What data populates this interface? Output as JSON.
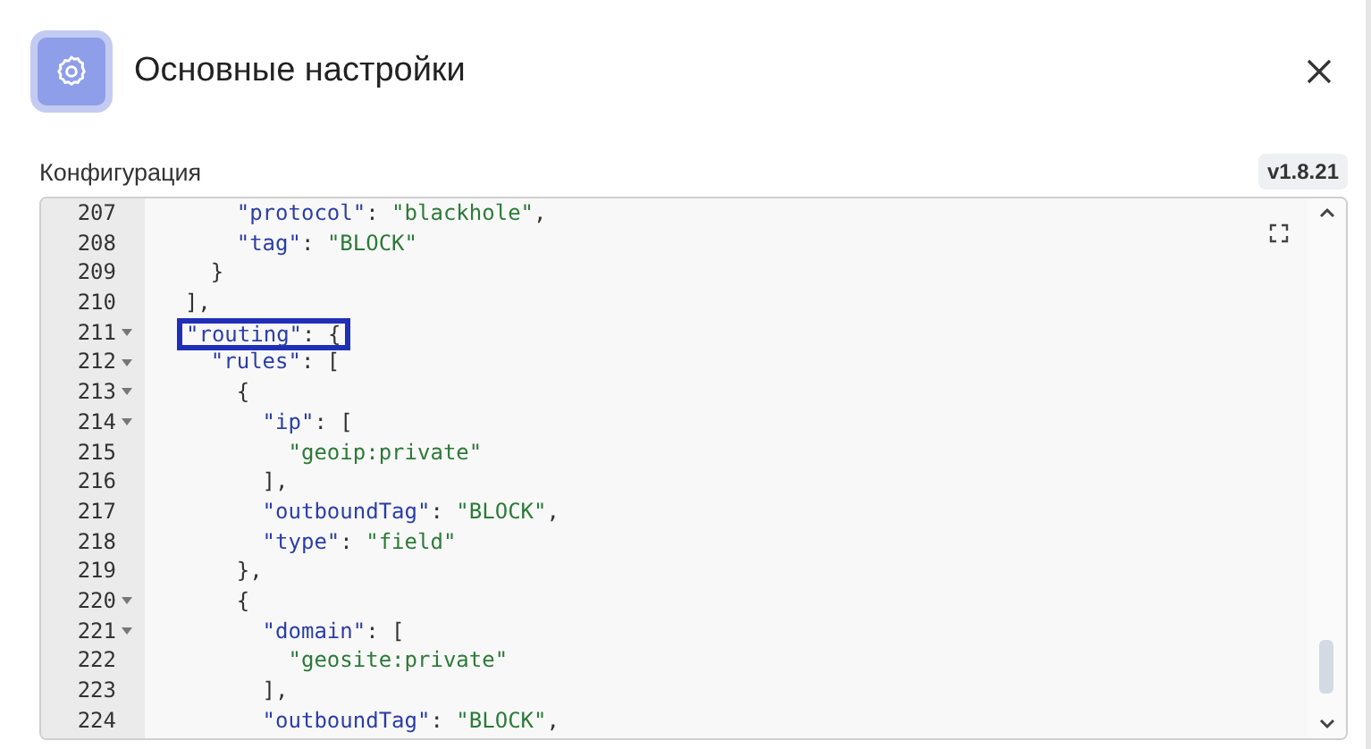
{
  "dialog": {
    "title": "Основные настройки"
  },
  "config": {
    "label": "Конфигурация",
    "version": "v1.8.21"
  },
  "editor": {
    "lines": [
      {
        "number": "207",
        "fold": false,
        "highlight": false,
        "tokens": [
          {
            "kind": "key",
            "text": "      \"protocol\""
          },
          {
            "kind": "punct",
            "text": ": "
          },
          {
            "kind": "string",
            "text": "\"blackhole\""
          },
          {
            "kind": "punct",
            "text": ","
          }
        ]
      },
      {
        "number": "208",
        "fold": false,
        "highlight": false,
        "tokens": [
          {
            "kind": "key",
            "text": "      \"tag\""
          },
          {
            "kind": "punct",
            "text": ": "
          },
          {
            "kind": "string",
            "text": "\"BLOCK\""
          }
        ]
      },
      {
        "number": "209",
        "fold": false,
        "highlight": false,
        "tokens": [
          {
            "kind": "punct",
            "text": "    }"
          }
        ]
      },
      {
        "number": "210",
        "fold": false,
        "highlight": false,
        "tokens": [
          {
            "kind": "punct",
            "text": "  ],"
          }
        ]
      },
      {
        "number": "211",
        "fold": true,
        "highlight": true,
        "tokens": [
          {
            "kind": "key",
            "text": "\"routing\""
          },
          {
            "kind": "punct",
            "text": ": {"
          }
        ]
      },
      {
        "number": "212",
        "fold": true,
        "highlight": false,
        "tokens": [
          {
            "kind": "key",
            "text": "    \"rules\""
          },
          {
            "kind": "punct",
            "text": ": ["
          }
        ]
      },
      {
        "number": "213",
        "fold": true,
        "highlight": false,
        "tokens": [
          {
            "kind": "punct",
            "text": "      {"
          }
        ]
      },
      {
        "number": "214",
        "fold": true,
        "highlight": false,
        "tokens": [
          {
            "kind": "key",
            "text": "        \"ip\""
          },
          {
            "kind": "punct",
            "text": ": ["
          }
        ]
      },
      {
        "number": "215",
        "fold": false,
        "highlight": false,
        "tokens": [
          {
            "kind": "string",
            "text": "          \"geoip:private\""
          }
        ]
      },
      {
        "number": "216",
        "fold": false,
        "highlight": false,
        "tokens": [
          {
            "kind": "punct",
            "text": "        ],"
          }
        ]
      },
      {
        "number": "217",
        "fold": false,
        "highlight": false,
        "tokens": [
          {
            "kind": "key",
            "text": "        \"outboundTag\""
          },
          {
            "kind": "punct",
            "text": ": "
          },
          {
            "kind": "string",
            "text": "\"BLOCK\""
          },
          {
            "kind": "punct",
            "text": ","
          }
        ]
      },
      {
        "number": "218",
        "fold": false,
        "highlight": false,
        "tokens": [
          {
            "kind": "key",
            "text": "        \"type\""
          },
          {
            "kind": "punct",
            "text": ": "
          },
          {
            "kind": "string",
            "text": "\"field\""
          }
        ]
      },
      {
        "number": "219",
        "fold": false,
        "highlight": false,
        "tokens": [
          {
            "kind": "punct",
            "text": "      },"
          }
        ]
      },
      {
        "number": "220",
        "fold": true,
        "highlight": false,
        "tokens": [
          {
            "kind": "punct",
            "text": "      {"
          }
        ]
      },
      {
        "number": "221",
        "fold": true,
        "highlight": false,
        "tokens": [
          {
            "kind": "key",
            "text": "        \"domain\""
          },
          {
            "kind": "punct",
            "text": ": ["
          }
        ]
      },
      {
        "number": "222",
        "fold": false,
        "highlight": false,
        "tokens": [
          {
            "kind": "string",
            "text": "          \"geosite:private\""
          }
        ]
      },
      {
        "number": "223",
        "fold": false,
        "highlight": false,
        "tokens": [
          {
            "kind": "punct",
            "text": "        ],"
          }
        ]
      },
      {
        "number": "224",
        "fold": false,
        "highlight": false,
        "tokens": [
          {
            "kind": "key",
            "text": "        \"outboundTag\""
          },
          {
            "kind": "punct",
            "text": ": "
          },
          {
            "kind": "string",
            "text": "\"BLOCK\""
          },
          {
            "kind": "punct",
            "text": ","
          }
        ]
      }
    ]
  }
}
